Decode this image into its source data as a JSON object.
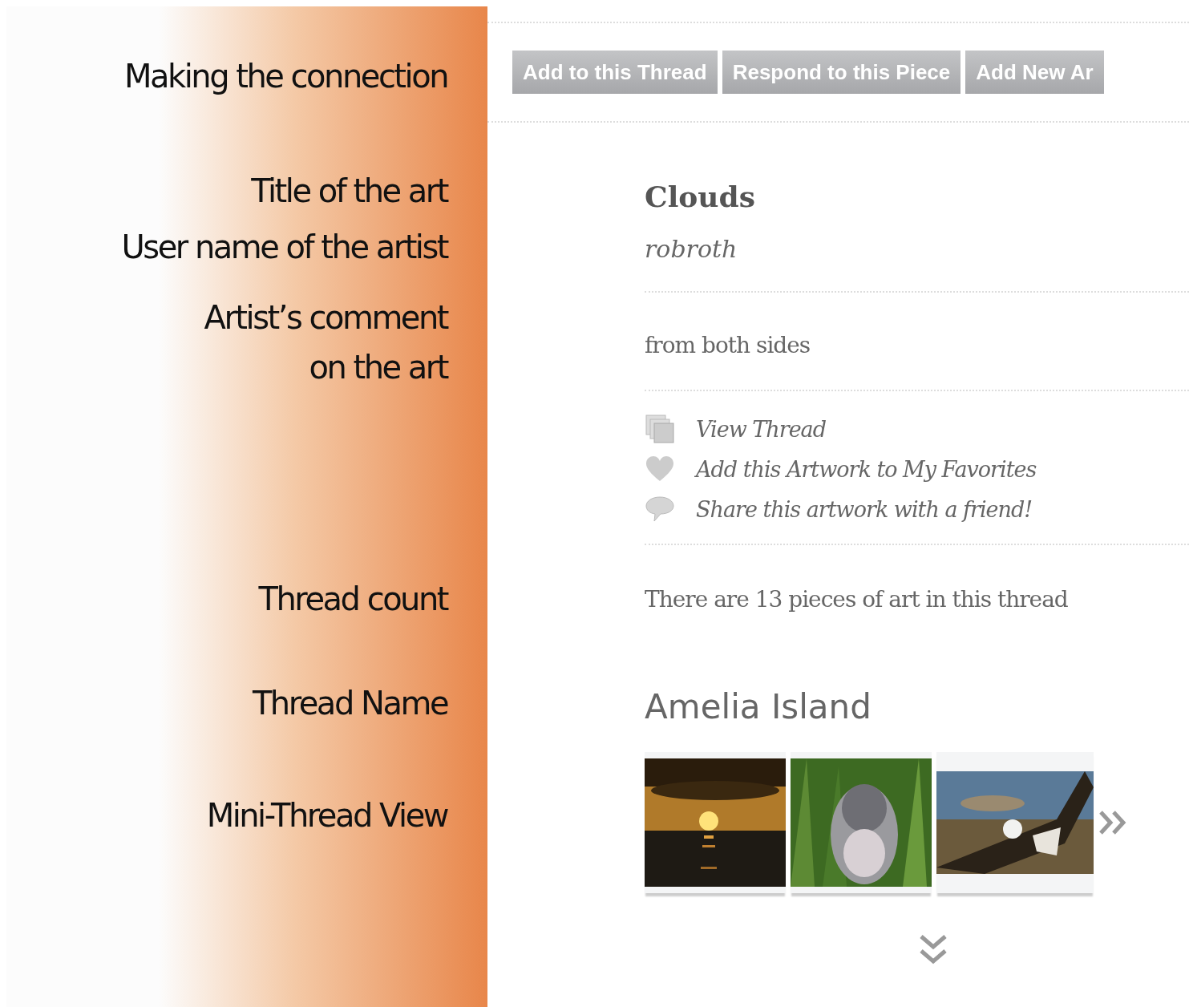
{
  "toolbar": {
    "annotation": "Making the connection",
    "buttons": [
      {
        "label": "Add to this Thread"
      },
      {
        "label": "Respond to this Piece"
      },
      {
        "label": "Add New Ar"
      }
    ]
  },
  "artwork": {
    "title_annotation": "Title of the art",
    "title": "Clouds",
    "artist_annotation": "User name of the artist",
    "artist": "robroth"
  },
  "comment": {
    "annotation": "Artist’s comment\non the art",
    "text": "from both sides"
  },
  "actions": [
    {
      "kind": "thread",
      "label": "View Thread"
    },
    {
      "kind": "favorite",
      "label": "Add this Artwork to My Favorites"
    },
    {
      "kind": "share",
      "label": "Share this artwork with a friend!"
    }
  ],
  "thread_count": {
    "annotation": "Thread count",
    "text": "There are 13 pieces of art in this thread"
  },
  "thread_name": {
    "annotation": "Thread Name",
    "text": "Amelia Island"
  },
  "mini_thread": {
    "annotation": "Mini-Thread View"
  }
}
